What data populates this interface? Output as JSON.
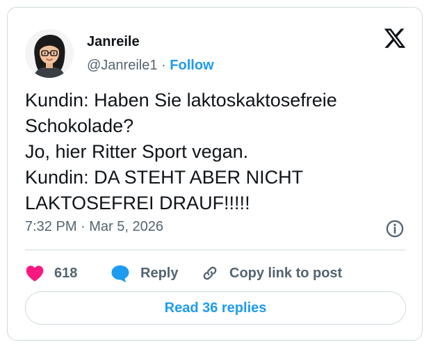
{
  "author": {
    "name": "Janreile",
    "handle": "@Janreile1",
    "separator": "·",
    "follow_label": "Follow"
  },
  "tweet": {
    "lines": [
      "Kundin: Haben Sie laktoskaktosefreie",
      "Schokolade?",
      "Jo, hier Ritter Sport vegan.",
      "Kundin: DA STEHT ABER NICHT",
      "LAKTOSEFREI DRAUF!!!!!"
    ],
    "timestamp": "7:32 PM · Mar 5, 2026"
  },
  "actions": {
    "like_count": "618",
    "reply_label": "Reply",
    "copy_label": "Copy link to post",
    "read_replies_label": "Read 36 replies"
  },
  "icons": {
    "logo": "x-logo-icon",
    "info": "info-icon",
    "like": "heart-icon",
    "reply": "speech-bubble-icon",
    "copy": "link-icon"
  },
  "colors": {
    "accent": "#1d9bf0",
    "heart": "#f91880",
    "text": "#0f1419",
    "secondary": "#536471",
    "border": "#cfd9de"
  }
}
